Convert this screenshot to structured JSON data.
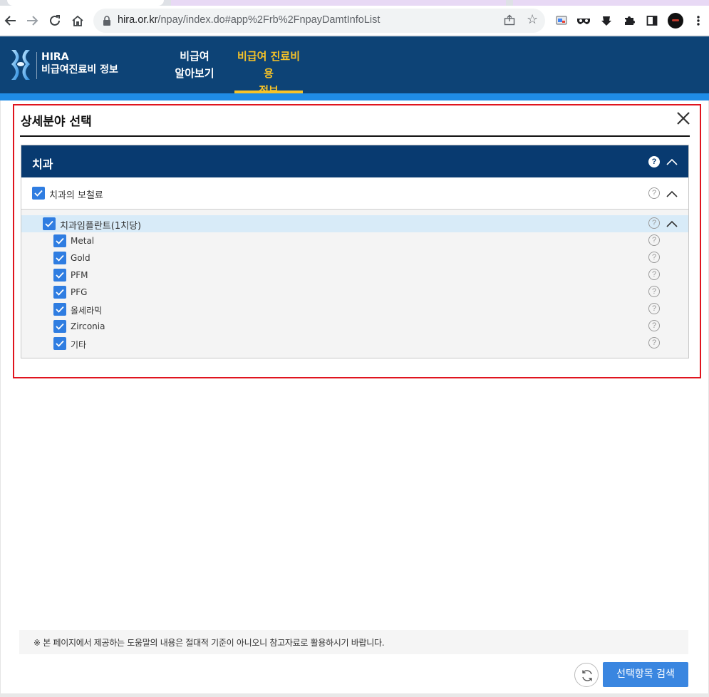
{
  "browser": {
    "url_host": "hira.or.kr",
    "url_path": "/npay/index.do#app%2Frb%2FnpayDamtInfoList"
  },
  "header": {
    "logo_line1": "HIRA",
    "logo_line2": "비급여진료비 정보",
    "nav": [
      {
        "line1": "비급여",
        "line2": "알아보기",
        "active": false
      },
      {
        "line1": "비급여 진료비용",
        "line2": "정보",
        "active": true
      }
    ]
  },
  "modal": {
    "title": "상세분야 선택",
    "category": "치과",
    "subcategory": "치과의 보철료",
    "group": "치과임플란트(1치당)",
    "items": [
      "Metal",
      "Gold",
      "PFM",
      "PFG",
      "올세라믹",
      "Zirconia",
      "기타"
    ],
    "help_glyph": "?"
  },
  "footer": {
    "notice": "※ 본 페이지에서 제공하는 도움말의 내용은 절대적 기준이 아니오니 참고자료로 활용하시기 바랍니다.",
    "search_button": "선택항목 검색"
  },
  "colors": {
    "header_bg": "#0d4376",
    "accent_yellow": "#f7c327",
    "category_bg": "#083a70",
    "checkbox": "#2f7de1",
    "highlight_row": "#d8ebf8",
    "search_button": "#3a86e0",
    "modal_outline": "#e0141e"
  }
}
